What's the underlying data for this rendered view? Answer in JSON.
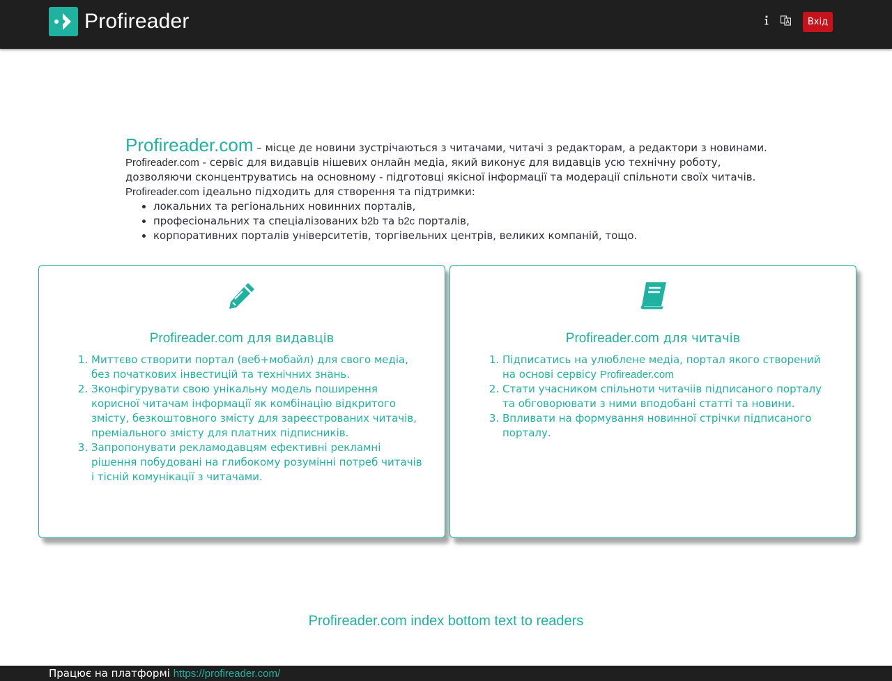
{
  "header": {
    "logo_text": "Profireader",
    "info_icon": "info-icon",
    "translate_icon": "translate-icon",
    "login_label": "Вхід"
  },
  "intro": {
    "brand": "Profireader.com",
    "tagline": " – місце де новини зустрічаються з читачами, читачі з редакторам, а редактори з новинами.",
    "p1_brand": "Profireader.com",
    "p1_text": " - сервіс для видавців нішевих онлайн медіа, який виконує для видавців усю технічну роботу, дозволяючи сконцентруватись на основному - підготовці якісної інформації та модерації спільноти своїх читачів.",
    "p2_brand": "Profireader.com",
    "p2_text": " ідеально підходить для створення та підтримки:",
    "bullets": [
      "локальних та регіональних новинних порталів,",
      "професіональних та спеціалізованих b2b та b2c порталів,",
      "корпоративних порталів університетів, торгівельних центрів, великих компаній, тощо."
    ]
  },
  "publishers": {
    "icon": "pencil-icon",
    "title_brand": "Profireader.com",
    "title_rest": " для видавців",
    "items": [
      "Миттєво створити портал (веб+мобайл) для свого медіа, без початкових інвестицій та технічних знань.",
      "Зконфігурувати свою унікальну модель поширення корисної читачам інформації як комбінацію відкритого змісту, безкоштовного змісту для зареєстрованих читачів, преміального змісту для платних підписників.",
      "Запропонувати рекламодавцям ефективні рекламні рішення побудовані на глибокому розумінні потреб читачів і тісній комунікації з читачами."
    ]
  },
  "readers": {
    "icon": "book-icon",
    "title_brand": "Profireader.com",
    "title_rest": " для читачів",
    "item1_text": "Підписатись на улюблене медіа, портал якого створений на основі сервісу ",
    "item1_brand": "Profireader.com",
    "item2": "Стати учасником спільноти читачіів підписаного порталу та обговорювати з ними вподобані статті та новини.",
    "item3": "Впливати на формування новинної стрічки підписаного порталу."
  },
  "bottom_text": "Profireader.com index bottom text to readers",
  "footer": {
    "label": "Працює на платформі ",
    "link": "https://profireader.com/"
  },
  "colors": {
    "accent": "#20b2a0",
    "header_bg": "#1f1f1f",
    "login_bg": "#c4131a"
  }
}
